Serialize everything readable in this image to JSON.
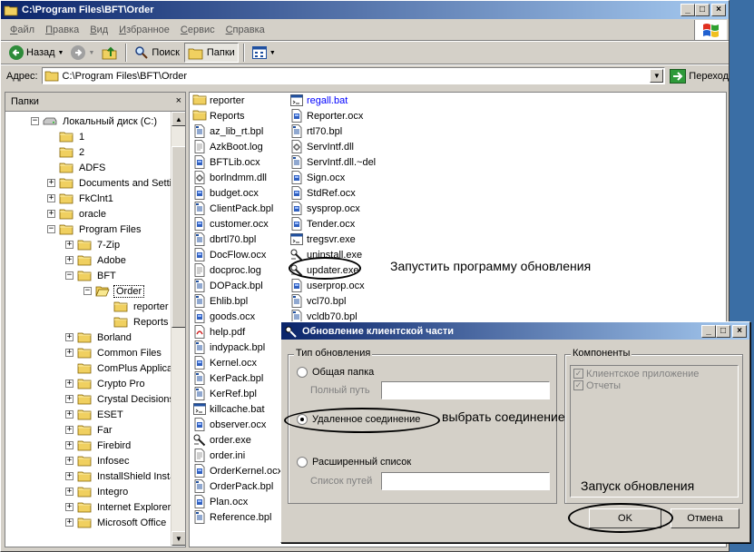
{
  "window": {
    "title": "C:\\Program Files\\BFT\\Order",
    "min_label": "_",
    "max_label": "□",
    "close_label": "×"
  },
  "menu": [
    "Файл",
    "Правка",
    "Вид",
    "Избранное",
    "Сервис",
    "Справка"
  ],
  "toolbar": {
    "back": "Назад",
    "search": "Поиск",
    "folders": "Папки"
  },
  "address": {
    "label": "Адрес:",
    "value": "C:\\Program Files\\BFT\\Order",
    "go": "Переход"
  },
  "folders_pane": {
    "title": "Папки",
    "close": "×",
    "tree": [
      {
        "label": "Локальный диск (C:)",
        "level": 0,
        "exp": "−",
        "icon": "drive"
      },
      {
        "label": "1",
        "level": 1,
        "exp": "",
        "icon": "folder"
      },
      {
        "label": "2",
        "level": 1,
        "exp": "",
        "icon": "folder"
      },
      {
        "label": "ADFS",
        "level": 1,
        "exp": "",
        "icon": "folder"
      },
      {
        "label": "Documents and Setti",
        "level": 1,
        "exp": "+",
        "icon": "folder"
      },
      {
        "label": "FkClnt1",
        "level": 1,
        "exp": "+",
        "icon": "folder"
      },
      {
        "label": "oracle",
        "level": 1,
        "exp": "+",
        "icon": "folder"
      },
      {
        "label": "Program Files",
        "level": 1,
        "exp": "−",
        "icon": "folder"
      },
      {
        "label": "7-Zip",
        "level": 2,
        "exp": "+",
        "icon": "folder"
      },
      {
        "label": "Adobe",
        "level": 2,
        "exp": "+",
        "icon": "folder"
      },
      {
        "label": "BFT",
        "level": 2,
        "exp": "−",
        "icon": "folder"
      },
      {
        "label": "Order",
        "level": 3,
        "exp": "−",
        "icon": "folder-open",
        "selected": true
      },
      {
        "label": "reporter",
        "level": 4,
        "exp": "",
        "icon": "folder"
      },
      {
        "label": "Reports",
        "level": 4,
        "exp": "",
        "icon": "folder"
      },
      {
        "label": "Borland",
        "level": 2,
        "exp": "+",
        "icon": "folder"
      },
      {
        "label": "Common Files",
        "level": 2,
        "exp": "+",
        "icon": "folder"
      },
      {
        "label": "ComPlus Applicat",
        "level": 2,
        "exp": "",
        "icon": "folder"
      },
      {
        "label": "Crypto Pro",
        "level": 2,
        "exp": "+",
        "icon": "folder"
      },
      {
        "label": "Crystal Decisions",
        "level": 2,
        "exp": "+",
        "icon": "folder"
      },
      {
        "label": "ESET",
        "level": 2,
        "exp": "+",
        "icon": "folder"
      },
      {
        "label": "Far",
        "level": 2,
        "exp": "+",
        "icon": "folder"
      },
      {
        "label": "Firebird",
        "level": 2,
        "exp": "+",
        "icon": "folder"
      },
      {
        "label": "Infosec",
        "level": 2,
        "exp": "+",
        "icon": "folder"
      },
      {
        "label": "InstallShield Insta",
        "level": 2,
        "exp": "+",
        "icon": "folder"
      },
      {
        "label": "Integro",
        "level": 2,
        "exp": "+",
        "icon": "folder"
      },
      {
        "label": "Internet Explorer",
        "level": 2,
        "exp": "+",
        "icon": "folder"
      },
      {
        "label": "Microsoft Office",
        "level": 2,
        "exp": "+",
        "icon": "folder"
      }
    ]
  },
  "files": {
    "col1": [
      {
        "name": "reporter",
        "icon": "folder"
      },
      {
        "name": "Reports",
        "icon": "folder"
      },
      {
        "name": "az_lib_rt.bpl",
        "icon": "bpl"
      },
      {
        "name": "AzkBoot.log",
        "icon": "text"
      },
      {
        "name": "BFTLib.ocx",
        "icon": "ocx"
      },
      {
        "name": "borlndmm.dll",
        "icon": "dll"
      },
      {
        "name": "budget.ocx",
        "icon": "ocx"
      },
      {
        "name": "ClientPack.bpl",
        "icon": "bpl"
      },
      {
        "name": "customer.ocx",
        "icon": "ocx"
      },
      {
        "name": "dbrtl70.bpl",
        "icon": "bpl"
      },
      {
        "name": "DocFlow.ocx",
        "icon": "ocx"
      },
      {
        "name": "docproc.log",
        "icon": "text"
      },
      {
        "name": "DOPack.bpl",
        "icon": "bpl"
      },
      {
        "name": "Ehlib.bpl",
        "icon": "bpl"
      },
      {
        "name": "goods.ocx",
        "icon": "ocx"
      },
      {
        "name": "help.pdf",
        "icon": "pdf"
      },
      {
        "name": "indypack.bpl",
        "icon": "bpl"
      },
      {
        "name": "Kernel.ocx",
        "icon": "ocx"
      },
      {
        "name": "KerPack.bpl",
        "icon": "bpl"
      },
      {
        "name": "KerRef.bpl",
        "icon": "bpl"
      },
      {
        "name": "killcache.bat",
        "icon": "bat"
      },
      {
        "name": "observer.ocx",
        "icon": "ocx"
      },
      {
        "name": "order.exe",
        "icon": "exe"
      },
      {
        "name": "order.ini",
        "icon": "text"
      },
      {
        "name": "OrderKernel.ocx",
        "icon": "ocx"
      },
      {
        "name": "OrderPack.bpl",
        "icon": "bpl"
      },
      {
        "name": "Plan.ocx",
        "icon": "ocx"
      },
      {
        "name": "Reference.bpl",
        "icon": "bpl"
      }
    ],
    "col2": [
      {
        "name": "regall.bat",
        "icon": "bat",
        "blue": true
      },
      {
        "name": "Reporter.ocx",
        "icon": "ocx"
      },
      {
        "name": "rtl70.bpl",
        "icon": "bpl"
      },
      {
        "name": "ServIntf.dll",
        "icon": "dll"
      },
      {
        "name": "ServIntf.dll.~del",
        "icon": "bpl"
      },
      {
        "name": "Sign.ocx",
        "icon": "ocx"
      },
      {
        "name": "StdRef.ocx",
        "icon": "ocx"
      },
      {
        "name": "sysprop.ocx",
        "icon": "ocx"
      },
      {
        "name": "Tender.ocx",
        "icon": "ocx"
      },
      {
        "name": "tregsvr.exe",
        "icon": "bat"
      },
      {
        "name": "uninstall.exe",
        "icon": "exe"
      },
      {
        "name": "updater.exe",
        "icon": "exe",
        "selected": true
      },
      {
        "name": "userprop.ocx",
        "icon": "ocx"
      },
      {
        "name": "vcl70.bpl",
        "icon": "bpl"
      },
      {
        "name": "vcldb70.bpl",
        "icon": "bpl"
      }
    ]
  },
  "annotations": {
    "run_updater": "Запустить программу обновления",
    "choose_connection": "выбрать соединение",
    "start_update": "Запуск обновления"
  },
  "dialog": {
    "title": "Обновление клиентской части",
    "update_type_group": "Тип обновления",
    "opt_shared": "Общая папка",
    "full_path_label": "Полный путь",
    "opt_remote": "Удаленное соединение",
    "opt_extended": "Расширенный список",
    "path_list_label": "Список путей",
    "components_group": "Компоненты",
    "components": [
      "Клиентское приложение",
      "Отчеты"
    ],
    "ok": "OK",
    "cancel": "Отмена"
  }
}
